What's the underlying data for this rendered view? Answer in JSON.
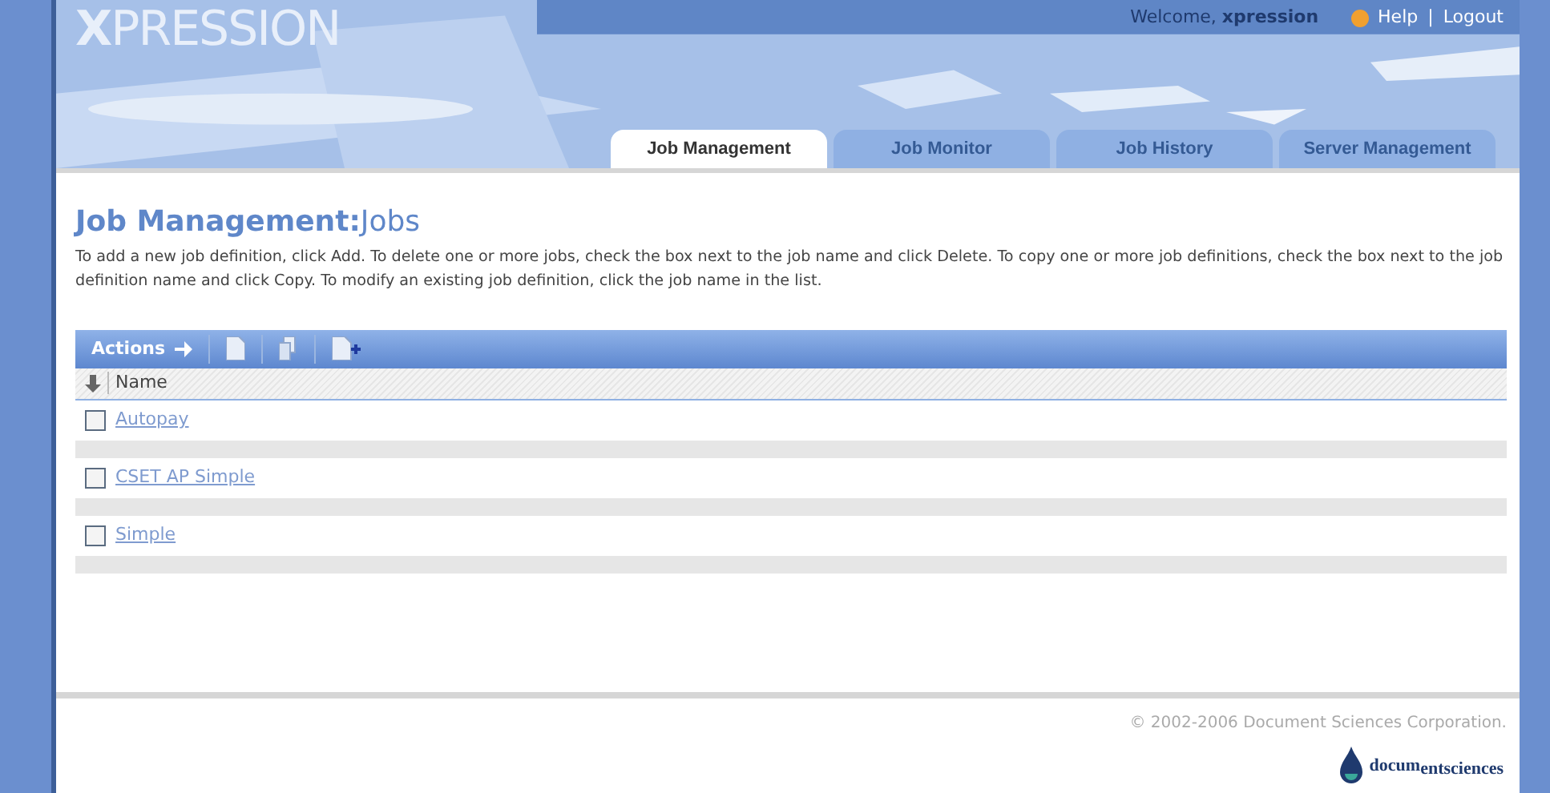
{
  "header": {
    "logo": "**X**PRESSION",
    "welcome": "Welcome, **xpression**",
    "links": [
      "Help",
      "|",
      "Logout"
    ]
  },
  "tabs": [
    {
      "label": "Job Management",
      "selected": true
    },
    {
      "label": "Job Monitor",
      "selected": false
    },
    {
      "label": "Job History",
      "selected": false
    },
    {
      "label": "Server Management",
      "selected": false
    }
  ],
  "page": {
    "title": "**Job Management:**Jobs",
    "description": "To add a new job definition, click Add. To delete one or more jobs, check the box next to the job name and click Delete. To copy one or more job definitions, check the box next to the job definition name and click Copy. To modify an existing job definition, click the job name in the list."
  },
  "toolbar": {
    "label": "Actions"
  },
  "table": {
    "columns": [
      "Name"
    ],
    "rows": [
      {
        "name": "Autopay",
        "checked": false
      },
      {
        "name": "CSET AP Simple",
        "checked": false
      },
      {
        "name": "Simple",
        "checked": false
      }
    ]
  },
  "footer": {
    "copyright": "© 2002-2006 Document Sciences Corporation.",
    "brand": "docum$_{ent}$$_{sciences}$"
  }
}
